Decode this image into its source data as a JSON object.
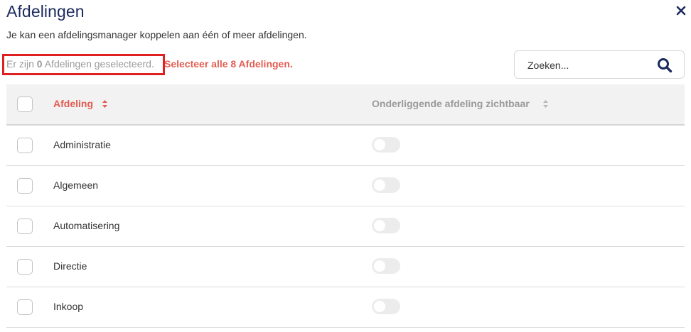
{
  "modal": {
    "title": "Afdelingen",
    "subtitle": "Je kan een afdelingsmanager koppelen aan één of meer afdelingen."
  },
  "selection": {
    "prefix": "Er zijn ",
    "count": "0",
    "suffix": " Afdelingen geselecteerd.",
    "select_all": "Selecteer alle 8 Afdelingen."
  },
  "search": {
    "placeholder": "Zoeken...",
    "value": ""
  },
  "table": {
    "headers": {
      "afdeling": "Afdeling",
      "onderliggend": "Onderliggende afdeling zichtbaar"
    },
    "rows": [
      {
        "name": "Administratie",
        "checked": false,
        "visible": false
      },
      {
        "name": "Algemeen",
        "checked": false,
        "visible": false
      },
      {
        "name": "Automatisering",
        "checked": false,
        "visible": false
      },
      {
        "name": "Directie",
        "checked": false,
        "visible": false
      },
      {
        "name": "Inkoop",
        "checked": false,
        "visible": false
      }
    ]
  },
  "colors": {
    "title": "#1c2a5e",
    "accent": "#e35d52",
    "highlight_box": "#e02020"
  },
  "icons": {
    "close": "close-icon",
    "search": "search-icon",
    "sort": "sort-icon"
  }
}
